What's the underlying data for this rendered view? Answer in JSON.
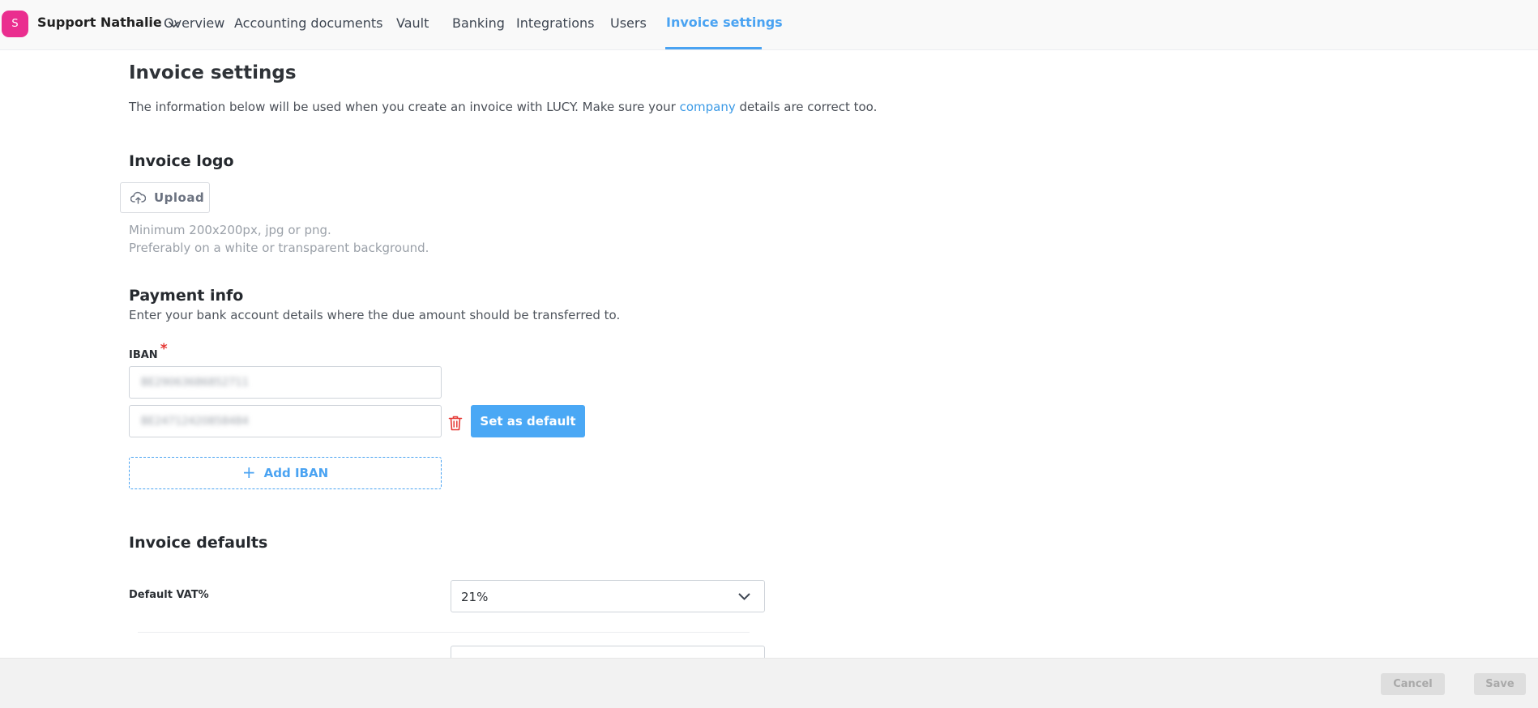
{
  "nav": {
    "avatar_initial": "S",
    "account_name": "Support Nathalie",
    "links": [
      "Overview",
      "Accounting documents",
      "Vault",
      "Banking",
      "Integrations",
      "Users",
      "Invoice settings"
    ],
    "active": "Invoice settings"
  },
  "page": {
    "title": "Invoice settings",
    "intro_before": "The information below will be used when you create an invoice with LUCY. Make sure your ",
    "intro_link": "company",
    "intro_after": " details are correct too."
  },
  "logo": {
    "heading": "Invoice logo",
    "upload_label": "Upload",
    "hint_line1": "Minimum 200x200px, jpg or png.",
    "hint_line2": "Preferably on a white or transparent background."
  },
  "payment": {
    "heading": "Payment info",
    "description": "Enter your bank account details where the due amount should be transferred to.",
    "iban_label": "IBAN",
    "required_mark": "*",
    "iban_values": [
      "BE29063686852711",
      "BE24712420858484"
    ],
    "set_default_label": "Set as default",
    "add_iban_label": "Add IBAN",
    "add_icon": "+"
  },
  "defaults": {
    "heading": "Invoice defaults",
    "vat_label": "Default VAT%",
    "vat_value": "21%"
  },
  "footer": {
    "cancel_label": "Cancel",
    "save_label": "Save"
  },
  "colors": {
    "accent": "#4aa3f2",
    "avatar": "#ea2e8f",
    "danger": "#e53935"
  }
}
